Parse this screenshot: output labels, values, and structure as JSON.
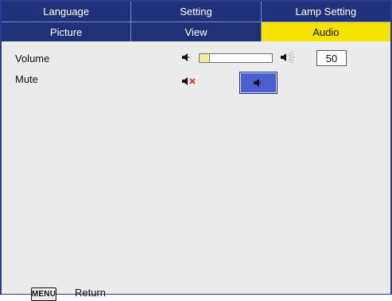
{
  "menu": {
    "top_tabs": [
      "Language",
      "Setting",
      "Lamp Setting"
    ],
    "bottom_tabs": [
      "Picture",
      "View",
      "Audio"
    ],
    "active_tab": "Audio"
  },
  "audio": {
    "volume_label": "Volume",
    "volume_value": "50",
    "volume_level_fraction": 0.13,
    "mute_label": "Mute"
  },
  "footer": {
    "menu_key": "MENU",
    "return_label": "Return"
  },
  "colors": {
    "tab_bg": "#1f3178",
    "active_tab_bg": "#f6e400",
    "mute_button_bg": "#4a5fd0",
    "mute_x_color": "#e53935"
  },
  "icons": {
    "volume_low": "speaker-low-icon",
    "volume_high": "speaker-high-icon",
    "mute_off": "speaker-muted-icon",
    "mute_on": "speaker-icon"
  }
}
